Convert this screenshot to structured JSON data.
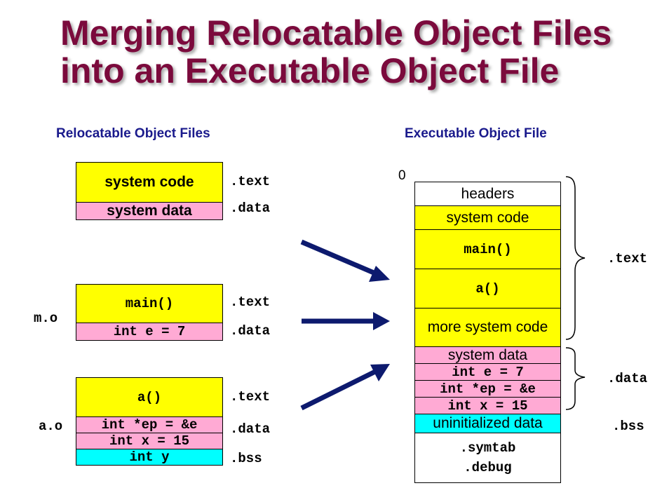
{
  "title": {
    "line1": "Merging Relocatable Object Files",
    "line2": "into an Executable Object File"
  },
  "left": {
    "heading": "Relocatable Object Files",
    "system": {
      "code": "system code",
      "data": "system data",
      "label_text": ".text",
      "label_data": ".data"
    },
    "m_o": {
      "name": "m.o",
      "code": "main()",
      "data": "int e = 7",
      "label_text": ".text",
      "label_data": ".data"
    },
    "a_o": {
      "name": "a.o",
      "code": "a()",
      "data1": "int *ep = &e",
      "data2": "int x = 15",
      "bss": "int y",
      "label_text": ".text",
      "label_data": ".data",
      "label_bss": ".bss"
    }
  },
  "right": {
    "heading": "Executable Object File",
    "zero": "0",
    "sections": {
      "headers": "headers",
      "system_code": "system code",
      "main": "main()",
      "a": "a()",
      "more_code": "more system code",
      "system_data": "system data",
      "int_e": "int e = 7",
      "int_ep": "int *ep = &e",
      "int_x": "int x = 15",
      "uninit": "uninitialized data",
      "symtab": ".symtab",
      "debug": ".debug"
    },
    "labels": {
      "text": ".text",
      "data": ".data",
      "bss": ".bss"
    }
  },
  "colors": {
    "title": "#7b0a3c",
    "heading": "#1a1a8c",
    "arrow": "#0d1a6e",
    "code": "#ffff00",
    "data": "#ffaad4",
    "bss": "#00ffff"
  }
}
